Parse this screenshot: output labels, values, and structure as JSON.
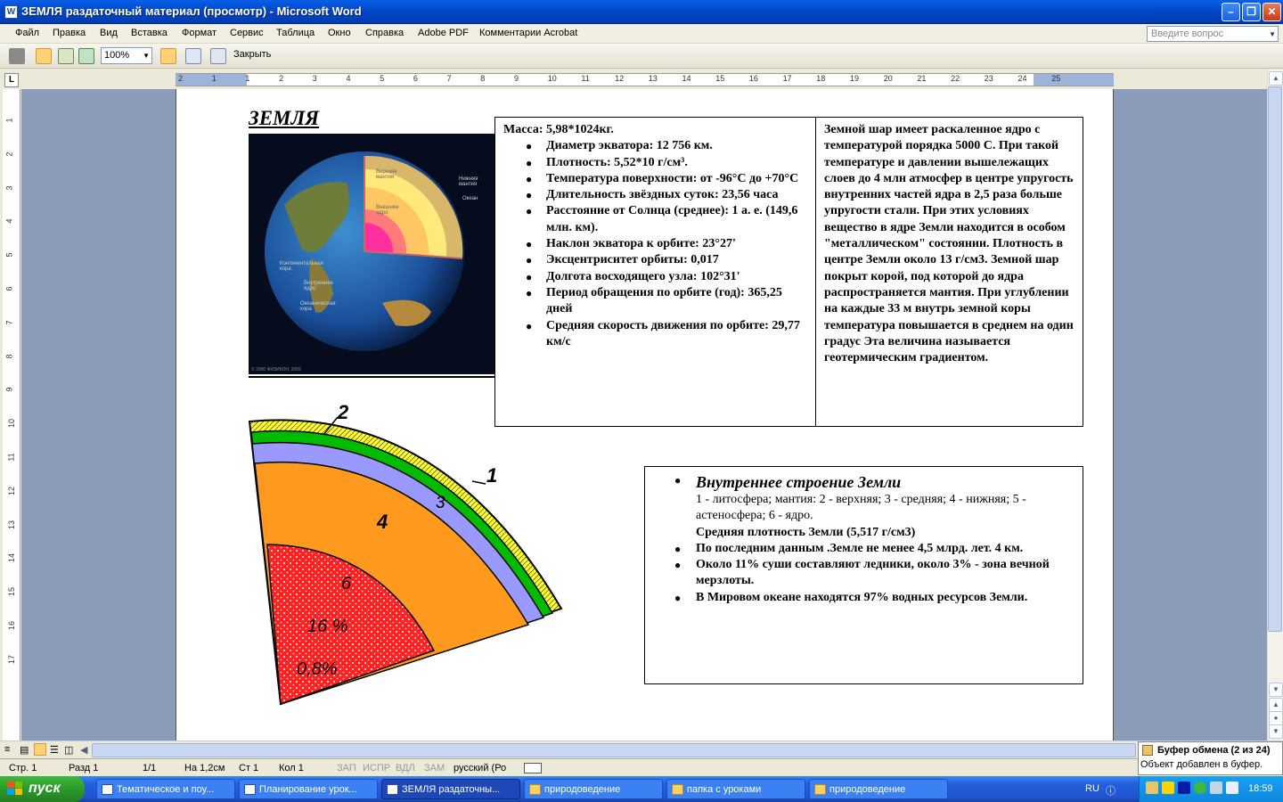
{
  "window": {
    "title": "ЗЕМЛЯ раздаточный материал (просмотр) - Microsoft Word",
    "app_icon": "W"
  },
  "menu": {
    "items": [
      "Файл",
      "Правка",
      "Вид",
      "Вставка",
      "Формат",
      "Сервис",
      "Таблица",
      "Окно",
      "Справка",
      "Adobe PDF",
      "Комментарии Acrobat"
    ],
    "help_placeholder": "Введите вопрос"
  },
  "toolbar": {
    "zoom": "100%",
    "close_label": "Закрыть"
  },
  "ruler": {
    "tab_symbol": "L",
    "h_numbers": [
      "2",
      "1",
      "1",
      "2",
      "3",
      "4",
      "5",
      "6",
      "7",
      "8",
      "9",
      "10",
      "11",
      "12",
      "13",
      "14",
      "15",
      "16",
      "17",
      "18",
      "19",
      "20",
      "21",
      "22",
      "23",
      "24",
      "25"
    ],
    "v_numbers": [
      "1",
      "2",
      "3",
      "4",
      "5",
      "6",
      "7",
      "8",
      "9",
      "10",
      "11",
      "12",
      "13",
      "14",
      "15",
      "16",
      "17"
    ]
  },
  "document": {
    "title": "ЗЕМЛЯ",
    "mass": "Масса:  5,98*1024кг.",
    "facts": [
      "Диаметр экватора: 12 756 км.",
      "Плотность:  5,52*10 г/см³.",
      "Температура поверхности:  от -96°C до +70°C",
      "Длительность звёздных суток:  23,56 часа",
      "Расстояние от Солнца (среднее):  1 а. е. (149,6 млн. км).",
      "Наклон экватора к орбите:  23°27'",
      "Эксцентриситет орбиты:  0,017",
      "Долгота восходящего узла:  102°31'",
      "Период обращения по орбите (год):  365,25 дней",
      "Средняя скорость движения по орбите:  29,77 км/с"
    ],
    "description": "Земной шар имеет раскаленное ядро с температурой порядка 5000 С. При такой температуре и давлении вышележащих слоев до 4 млн атмосфер в центре упругость внутренних частей ядра в 2,5 раза больше упругости стали. При этих условиях вещество в ядре Земли находится в особом \"металлическом\" состоянии. Плотность в центре Земли около 13 г/см3. Земной шар покрыт корой, под которой до ядра распространяется мантия. При углублении на каждые 33 м внутрь земной коры температура повышается в среднем на один градус Эта величина называется геотермическим градиентом.",
    "photo_labels": [
      "Верхняя мантия",
      "Нижняя мантия",
      "Океан",
      "Внешнее ядро",
      "Континентальная кора",
      "Внутреннее ядро",
      "Океаническая кора"
    ],
    "photo_credit": "© 2000 ФИЗИКОН, 2005",
    "layers": {
      "heading": "Внутреннее строение Земли",
      "legend": "1 - литосфера; мантия: 2 - верхняя; 3 - средняя;    4 - нижняя; 5 - астеносфера; 6 - ядро.",
      "density": "Средняя плотность Земли (5,517 г/см3)",
      "items": [
        "По последним данным .Земле не менее 4,5 млрд. лет. 4 км.",
        " Около 11% суши составляют ледники, около 3% - зона вечной мерзлоты.",
        "В Мировом океане находятся 97% водных ресурсов Земли."
      ]
    },
    "diagram": {
      "label1": "1",
      "label2": "2",
      "label3": "3",
      "label4": "4",
      "label6": "6",
      "pct1": "16 %",
      "pct2": "0,8%"
    }
  },
  "statusbar": {
    "page": "Стр.  1",
    "section": "Разд  1",
    "pages": "1/1",
    "at": "На  1,2см",
    "line": "Ст   1",
    "col": "Кол   1",
    "rec": "ЗАП",
    "trk": "ИСПР",
    "ext": "ВДЛ",
    "ovr": "ЗАМ",
    "lang": "русский (Ро"
  },
  "clipboard": {
    "title": "Буфер обмена (2 из 24)",
    "text": "Объект добавлен в буфер."
  },
  "taskbar": {
    "start": "пуск",
    "tasks": [
      "Тематическое и поу...",
      "Планирование  урок...",
      "ЗЕМЛЯ раздаточны...",
      "природоведение",
      "папка с уроками",
      "природоведение"
    ],
    "lang": "RU",
    "clock": "18:59"
  },
  "colors": {
    "titlebar": "#0a5fe8",
    "taskbar": "#245edc",
    "start": "#2b9a2b",
    "workspace": "#8a9cb8"
  }
}
